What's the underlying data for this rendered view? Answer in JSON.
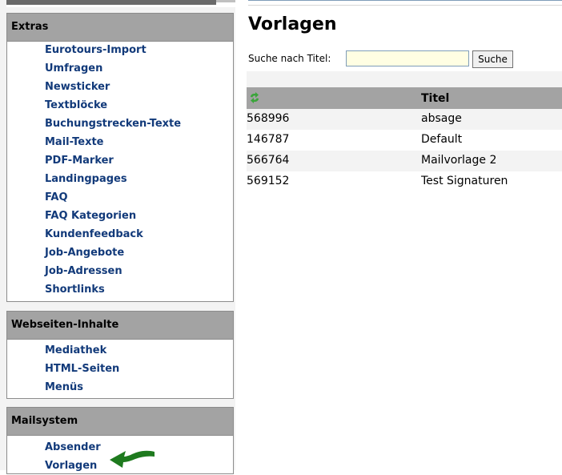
{
  "sidebar": {
    "panels": [
      {
        "title": "Extras",
        "items": [
          "Eurotours-Import",
          "Umfragen",
          "Newsticker",
          "Textblöcke",
          "Buchungstrecken-Texte",
          "Mail-Texte",
          "PDF-Marker",
          "Landingpages",
          "FAQ",
          "FAQ Kategorien",
          "Kundenfeedback",
          "Job-Angebote",
          "Job-Adressen",
          "Shortlinks"
        ]
      },
      {
        "title": "Webseiten-Inhalte",
        "items": [
          "Mediathek",
          "HTML-Seiten",
          "Menüs"
        ]
      },
      {
        "title": "Mailsystem",
        "items": [
          "Absender",
          "Vorlagen"
        ]
      }
    ]
  },
  "main": {
    "title": "Vorlagen",
    "search": {
      "label": "Suche nach Titel:",
      "value": "",
      "button": "Suche"
    },
    "table": {
      "header": {
        "icon": "refresh-icon",
        "title": "Titel"
      },
      "rows": [
        {
          "id": "568996",
          "title": "absage"
        },
        {
          "id": "146787",
          "title": "Default"
        },
        {
          "id": "566764",
          "title": "Mailvorlage 2"
        },
        {
          "id": "569152",
          "title": "Test Signaturen"
        }
      ]
    }
  },
  "colors": {
    "menu_link": "#123a7a",
    "panel_header": "#a3a3a3",
    "annotation_arrow": "#1e7a1e",
    "search_input_bg": "#fffee3"
  }
}
